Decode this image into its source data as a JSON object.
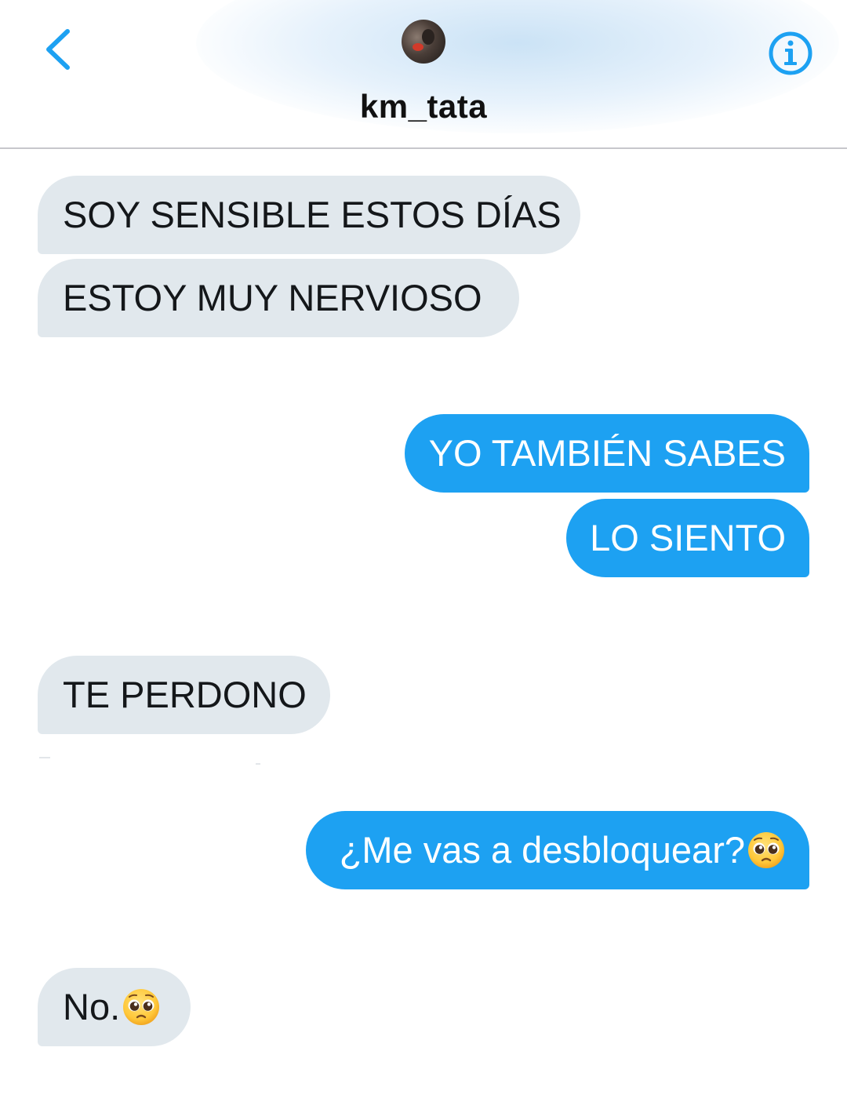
{
  "header": {
    "contact_name": "km_tata",
    "back_icon": "chevron-left-icon",
    "info_icon": "info-circle-icon",
    "accent_color": "#1da1f2"
  },
  "messages": [
    {
      "direction": "received",
      "text": "SOY SENSIBLE ESTOS DÍAS"
    },
    {
      "direction": "received",
      "text": "ESTOY MUY NERVIOSO"
    },
    {
      "direction": "sent",
      "text": "YO TAMBIÉN SABES"
    },
    {
      "direction": "sent",
      "text": "LO SIENTO"
    },
    {
      "direction": "received",
      "text": "TE PERDONO"
    },
    {
      "direction": "sent",
      "text": "¿Me vas a desbloquear?",
      "emoji": "pleading-face-emoji"
    },
    {
      "direction": "received",
      "text": "No.",
      "emoji": "pleading-face-emoji"
    }
  ],
  "colors": {
    "received_bubble": "#e1e8ed",
    "sent_bubble": "#1da1f2",
    "received_text": "#14171a",
    "sent_text": "#ffffff"
  }
}
